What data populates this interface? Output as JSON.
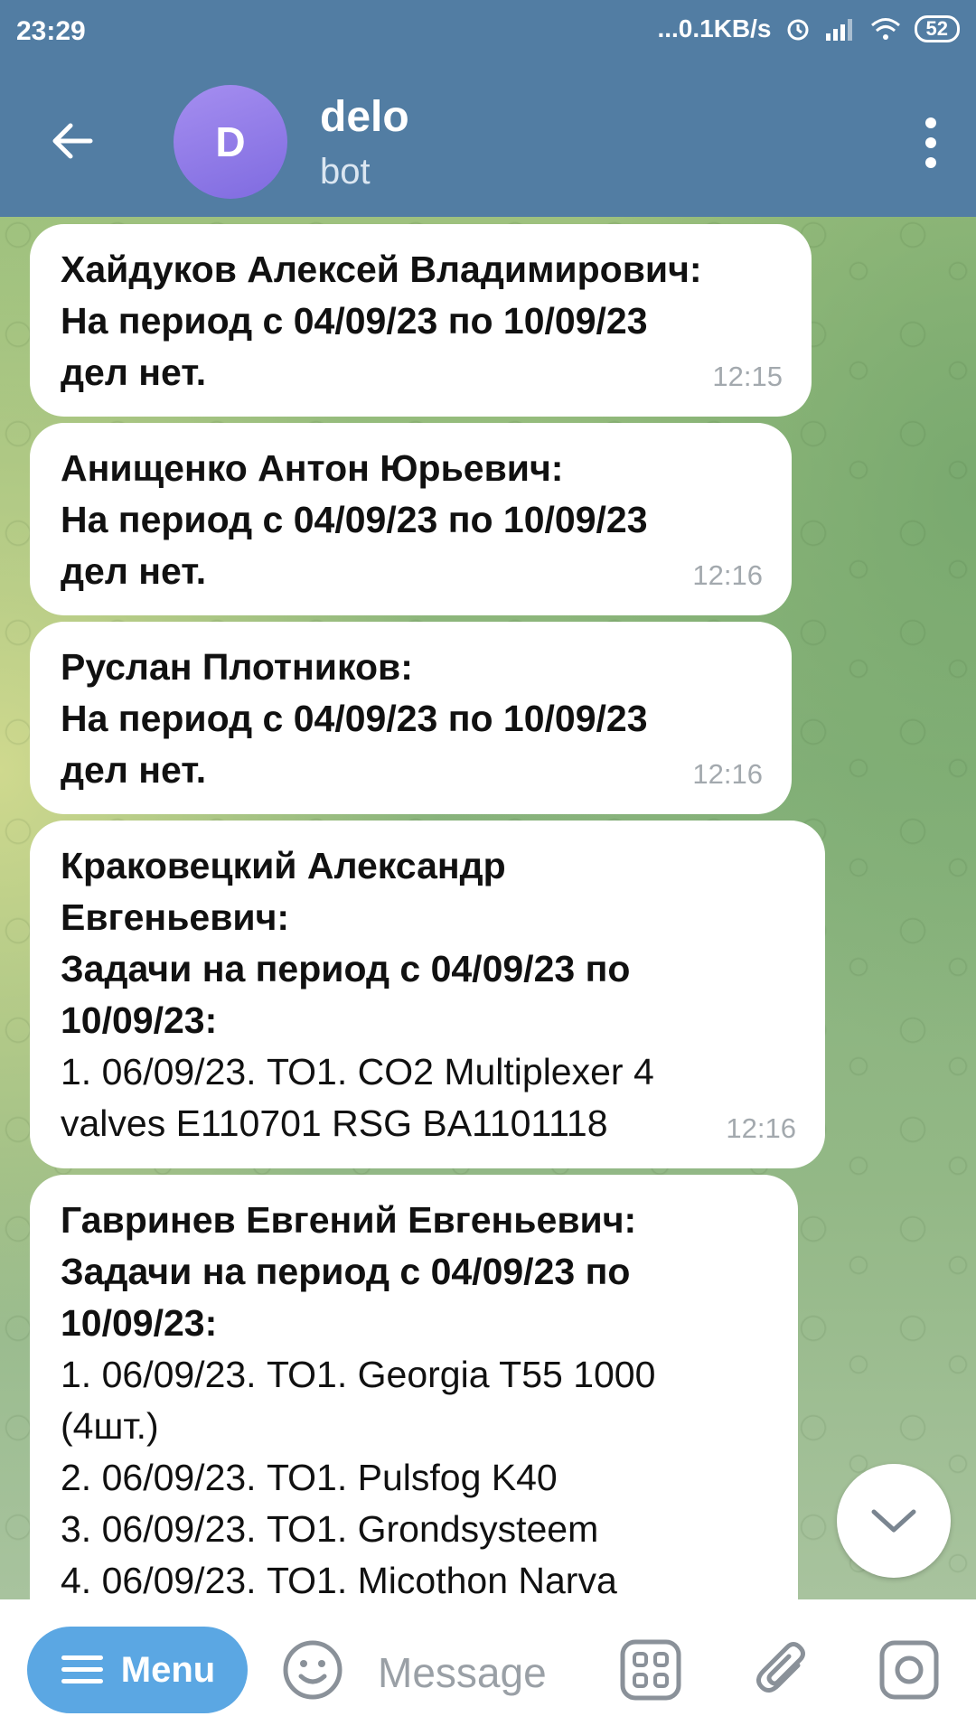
{
  "statusbar": {
    "time": "23:29",
    "speed": "...0.1KB/s",
    "battery": "52",
    "icons": [
      "alarm-icon",
      "signal-icon",
      "wifi-icon",
      "battery-icon"
    ]
  },
  "header": {
    "avatar_letter": "D",
    "title": "delo",
    "subtitle": "bot",
    "colors": {
      "bar": "#527da3",
      "avatar": "#8f78e8"
    }
  },
  "messages": [
    {
      "lines": [
        "Хайдуков Алексей Владимирович:",
        "На период с 04/09/23 по 10/09/23",
        "дел нет."
      ],
      "time": "12:15"
    },
    {
      "lines": [
        "Анищенко Антон Юрьевич:",
        "На период с 04/09/23 по 10/09/23",
        "дел нет."
      ],
      "time": "12:16"
    },
    {
      "lines": [
        "Руслан Плотников:",
        "На период с 04/09/23 по 10/09/23",
        "дел нет."
      ],
      "time": "12:16"
    },
    {
      "bold_lines": [
        "Краковецкий Александр",
        "Евгеньевич:",
        "Задачи на период с 04/09/23 по",
        "10/09/23:"
      ],
      "lines": [
        "1. 06/09/23. ТО1. CO2 Multiplexer 4",
        "valves E110701 RSG BA1101118"
      ],
      "time": "12:16"
    },
    {
      "bold_lines": [
        "Гавринев Евгений Евгеньевич:",
        "Задачи на период с 04/09/23 по",
        "10/09/23:"
      ],
      "lines": [
        "1. 06/09/23. ТО1. Georgia T55 1000",
        "(4шт.)",
        "2. 06/09/23. ТО1. Pulsfog K40",
        "3. 06/09/23. ТО1. Grondsysteem",
        "4. 06/09/23. ТО1. Micothon Narva"
      ]
    }
  ],
  "input": {
    "menu_label": "Menu",
    "placeholder": "Message"
  },
  "colors": {
    "menu_button": "#5ba7e3"
  }
}
